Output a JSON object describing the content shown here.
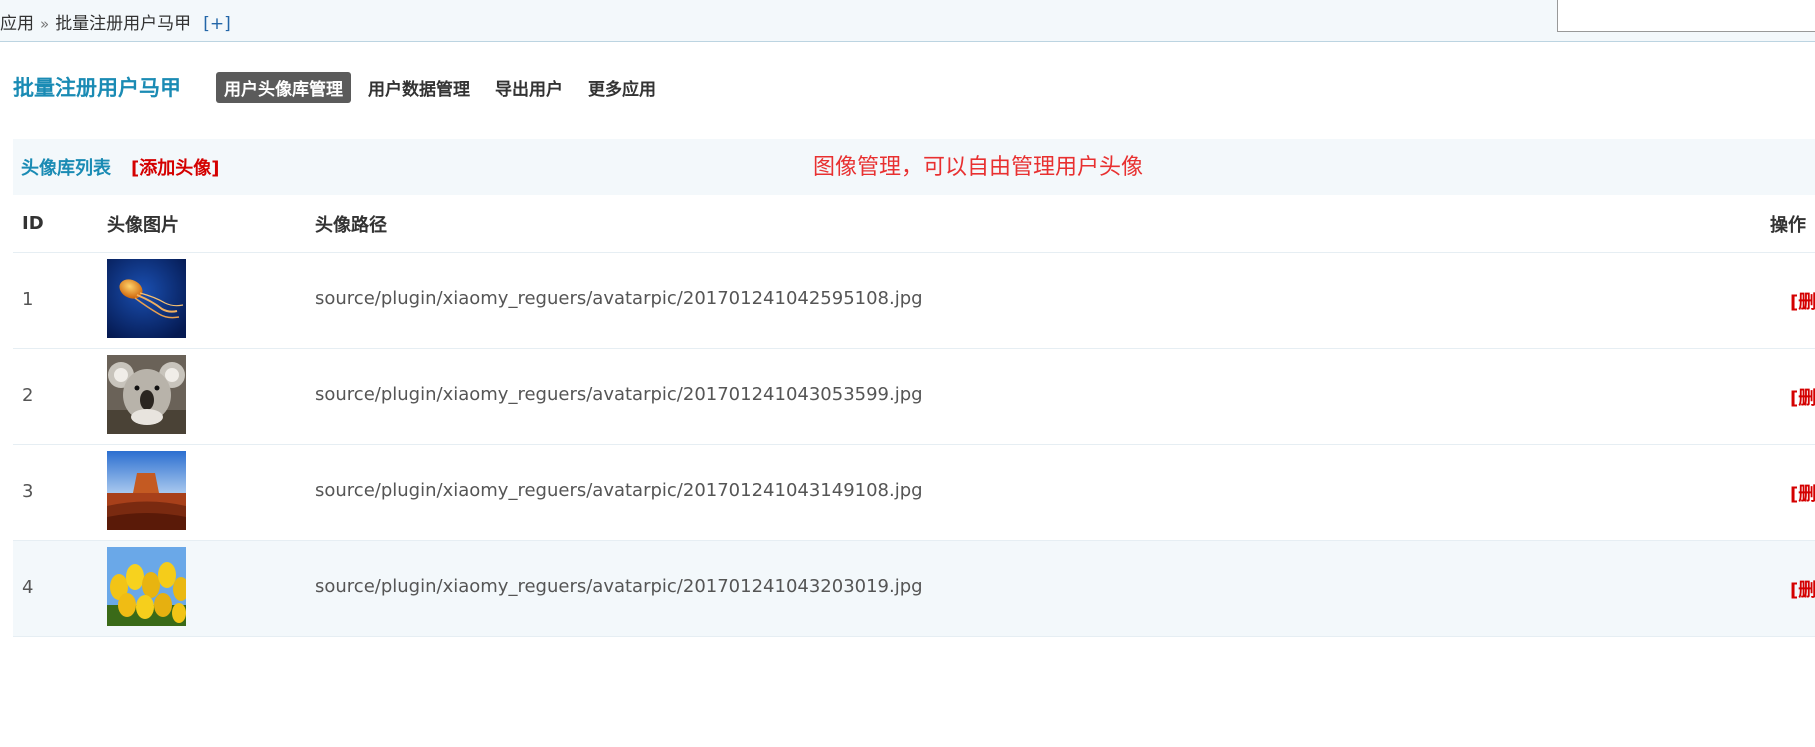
{
  "topbar": {
    "crumb_root": "应用",
    "crumb_sep": "»",
    "crumb_current": "批量注册用户马甲",
    "plus": "[+]"
  },
  "plugin": {
    "title": "批量注册用户马甲",
    "tabs": [
      {
        "label": "用户头像库管理",
        "active": true
      },
      {
        "label": "用户数据管理",
        "active": false
      },
      {
        "label": "导出用户",
        "active": false
      },
      {
        "label": "更多应用",
        "active": false
      }
    ]
  },
  "list": {
    "title": "头像库列表",
    "add_label": "[添加头像]",
    "annotation": "图像管理，可以自由管理用户头像",
    "columns": {
      "id": "ID",
      "image": "头像图片",
      "path": "头像路径",
      "op": "操作"
    },
    "rows": [
      {
        "id": "1",
        "path": "source/plugin/xiaomy_reguers/avatarpic/201701241042595108.jpg",
        "op": "[删",
        "thumb": "jellyfish"
      },
      {
        "id": "2",
        "path": "source/plugin/xiaomy_reguers/avatarpic/201701241043053599.jpg",
        "op": "[删",
        "thumb": "koala"
      },
      {
        "id": "3",
        "path": "source/plugin/xiaomy_reguers/avatarpic/201701241043149108.jpg",
        "op": "[删",
        "thumb": "desert"
      },
      {
        "id": "4",
        "path": "source/plugin/xiaomy_reguers/avatarpic/201701241043203019.jpg",
        "op": "[删",
        "thumb": "tulips"
      }
    ]
  },
  "colors": {
    "accent_blue": "#1a8bb4",
    "link_red": "#d40000",
    "annotation_red": "#e83030",
    "row_alt_bg": "#f3f8fb"
  }
}
